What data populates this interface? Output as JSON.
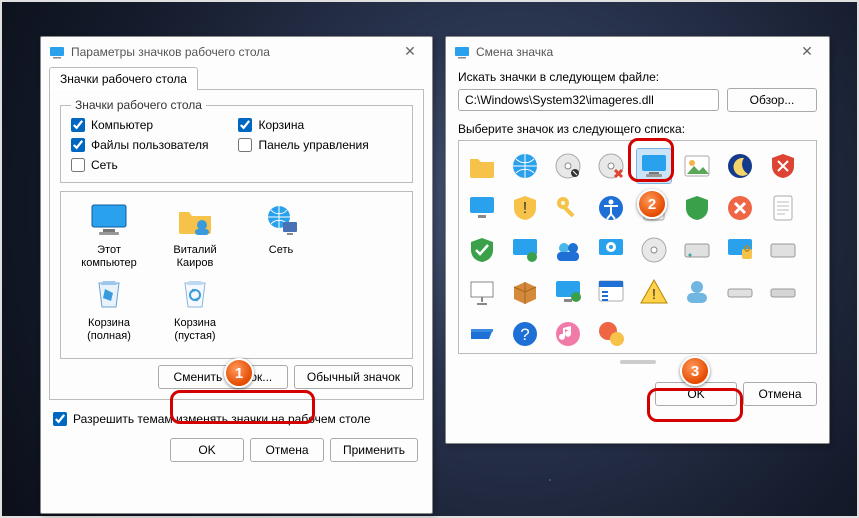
{
  "left": {
    "title": "Параметры значков рабочего стола",
    "tab": "Значки рабочего стола",
    "group_legend": "Значки рабочего стола",
    "checks": {
      "computer": {
        "label": "Компьютер",
        "checked": true
      },
      "userfiles": {
        "label": "Файлы пользователя",
        "checked": true
      },
      "network": {
        "label": "Сеть",
        "checked": false
      },
      "recycle": {
        "label": "Корзина",
        "checked": true
      },
      "control": {
        "label": "Панель управления",
        "checked": false
      }
    },
    "icons": [
      {
        "label1": "Этот",
        "label2": "компьютер",
        "kind": "monitor"
      },
      {
        "label1": "Виталий",
        "label2": "Каиров",
        "kind": "user"
      },
      {
        "label1": "Сеть",
        "label2": "",
        "kind": "globe"
      },
      {
        "label1": "Корзина",
        "label2": "(полная)",
        "kind": "bin-full"
      },
      {
        "label1": "Корзина",
        "label2": "(пустая)",
        "kind": "bin-empty"
      }
    ],
    "change_btn": "Сменить значок...",
    "default_btn": "Обычный значок",
    "allow_themes": "Разрешить темам изменять значки на рабочем столе",
    "ok": "OK",
    "cancel": "Отмена",
    "apply": "Применить"
  },
  "right": {
    "title": "Смена значка",
    "path_label": "Искать значки в следующем файле:",
    "path_value": "C:\\Windows\\System32\\imageres.dll",
    "browse": "Обзор...",
    "list_label": "Выберите значок из следующего списка:",
    "ok": "OK",
    "cancel": "Отмена"
  },
  "callouts": {
    "1": "1",
    "2": "2",
    "3": "3"
  }
}
